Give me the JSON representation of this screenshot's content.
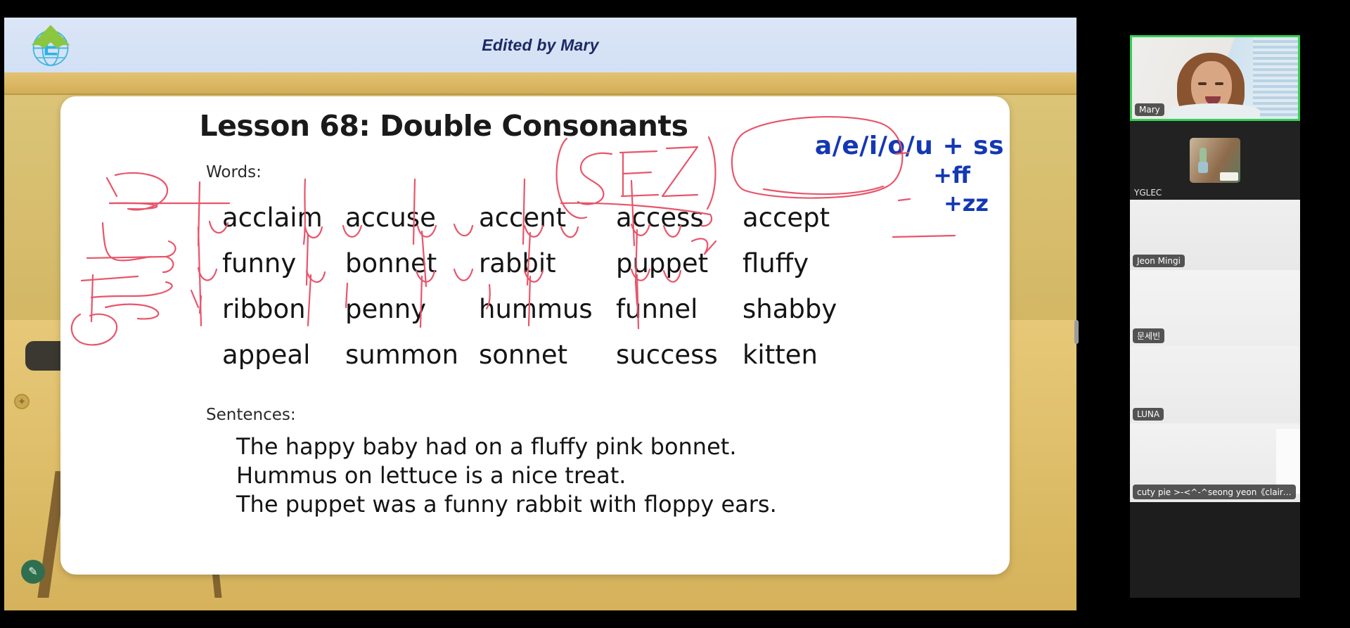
{
  "header": {
    "title": "Edited by Mary",
    "logo_icon": "yglec-globe-logo"
  },
  "slide": {
    "title": "Lesson 68: Double Consonants",
    "words_label": "Words:",
    "sentences_label": "Sentences:",
    "words": [
      [
        "acclaim",
        "accuse",
        "accent",
        "access",
        "accept"
      ],
      [
        "funny",
        "bonnet",
        "rabbit",
        "puppet",
        "fluffy"
      ],
      [
        "ribbon",
        "penny",
        "hummus",
        "funnel",
        "shabby"
      ],
      [
        "appeal",
        "summon",
        "sonnet",
        "success",
        "kitten"
      ]
    ],
    "sentences": [
      "The happy baby had on a fluffy pink bonnet.",
      "Hummus on lettuce is a nice treat.",
      "The puppet was a funny rabbit with floppy ears."
    ],
    "annotations": {
      "rule_line1": "a/e/i/o/u + ss",
      "rule_line2": "+ff",
      "rule_line3": "+zz",
      "red_mark_text": "SEZ",
      "rule_color": "#1438b4",
      "ink_color": "#e8556b"
    }
  },
  "video_rail": {
    "participants": [
      {
        "name": "Mary",
        "active_speaker": true,
        "border_color": "#34d254"
      },
      {
        "name": "YGLEC",
        "active_speaker": false
      },
      {
        "name": "Jeon Mingi",
        "active_speaker": false
      },
      {
        "name": "문세빈",
        "active_speaker": false
      },
      {
        "name": "LUNA",
        "active_speaker": false
      },
      {
        "name": "cuty pie >-<^-^seong yeon《claire》",
        "active_speaker": false
      }
    ]
  },
  "tools": {
    "pen_icon": "pencil-icon"
  }
}
